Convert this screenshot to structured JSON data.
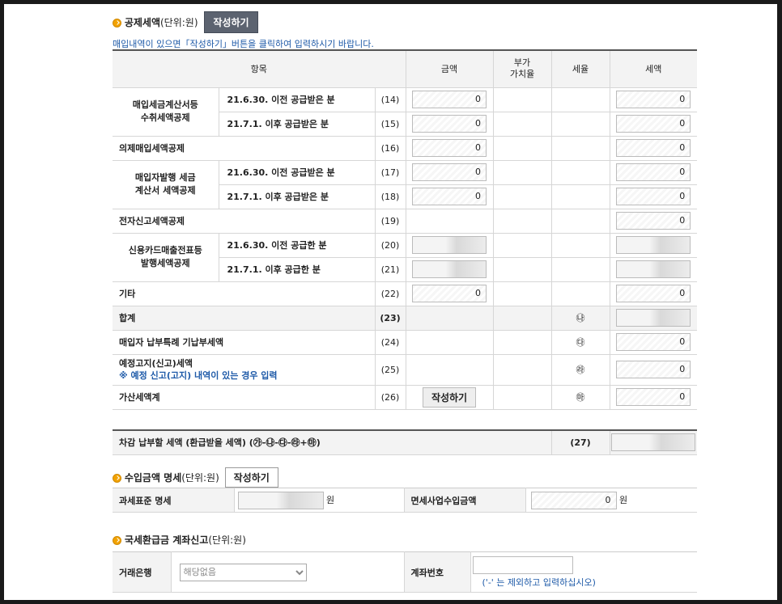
{
  "deduction": {
    "title": "공제세액",
    "unit": "(단위:원)",
    "write_button": "작성하기",
    "notice": "매입내역이 있으면「작성하기」버튼을 클릭하여 입력하시기 바랍니다.",
    "headers": {
      "item": "항목",
      "amount": "금액",
      "vat_rate": "부가\n가치율",
      "tax_rate": "세율",
      "tax": "세액"
    },
    "groups": {
      "tax_invoice": "매입세금계산서등\n수취세액공제",
      "buyer_issued": "매입자발행 세금\n계산서 세액공제",
      "credit_card": "신용카드매출전표등\n발행세액공제"
    },
    "rows": [
      {
        "label": "21.6.30. 이전 공급받은 분",
        "no": "(14)",
        "amount": "0",
        "rate": "",
        "tax": "0"
      },
      {
        "label": "21.7.1. 이후 공급받은 분",
        "no": "(15)",
        "amount": "0",
        "rate": "",
        "tax": "0"
      },
      {
        "label": "의제매입세액공제",
        "no": "(16)",
        "amount": "0",
        "rate": "",
        "tax": "0"
      },
      {
        "label": "21.6.30. 이전 공급받은 분",
        "no": "(17)",
        "amount": "0",
        "rate": "",
        "tax": "0"
      },
      {
        "label": "21.7.1. 이후 공급받은 분",
        "no": "(18)",
        "amount": "0",
        "rate": "",
        "tax": "0"
      },
      {
        "label": "전자신고세액공제",
        "no": "(19)",
        "amount": "",
        "rate": "",
        "tax": "0"
      },
      {
        "label": "21.6.30. 이전 공급한 분",
        "no": "(20)",
        "amount": "",
        "rate": "",
        "tax": ""
      },
      {
        "label": "21.7.1. 이후 공급한 분",
        "no": "(21)",
        "amount": "",
        "rate": "",
        "tax": ""
      },
      {
        "label": "기타",
        "no": "(22)",
        "amount": "0",
        "rate": "",
        "tax": "0"
      },
      {
        "label": "합계",
        "no": "(23)",
        "amount": "",
        "rate": "㉯",
        "tax": ""
      },
      {
        "label": "매입자 납부특례 기납부세액",
        "no": "(24)",
        "amount": "",
        "rate": "㉰",
        "tax": "0"
      },
      {
        "label": "예정고지(신고)세액",
        "sublabel": "※ 예정 신고(고지) 내역이 있는 경우 입력",
        "no": "(25)",
        "amount": "",
        "rate": "㉱",
        "tax": "0"
      },
      {
        "label": "가산세액계",
        "no": "(26)",
        "amount_button": "작성하기",
        "rate": "㉲",
        "tax": "0"
      }
    ],
    "final": {
      "label": "차감 납부할 세액 (환급받을 세액) (㉮-㉯-㉰-㉱+㉲)",
      "no": "(27)"
    }
  },
  "income": {
    "title": "수입금액 명세",
    "unit": "(단위:원)",
    "write_button": "작성하기",
    "tax_base_label": "과세표준 명세",
    "tax_base_unit": "원",
    "exempt_label": "면세사업수입금액",
    "exempt_value": "0",
    "exempt_unit": "원"
  },
  "refund": {
    "title": "국세환급금 계좌신고",
    "unit": "(단위:원)",
    "bank_label": "거래은행",
    "bank_selected": "해당없음",
    "account_label": "계좌번호",
    "account_hint": "('-' 는 제외하고 입력하십시오)"
  }
}
